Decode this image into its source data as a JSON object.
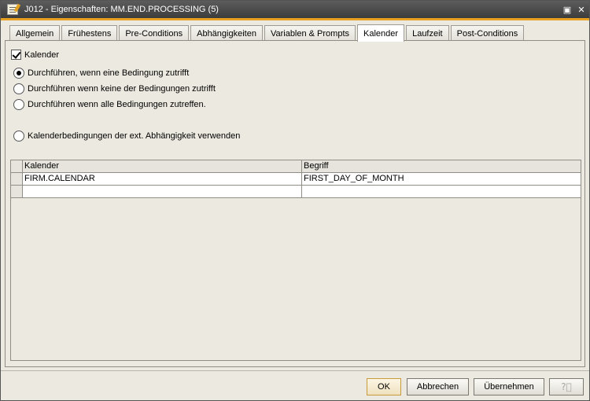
{
  "window": {
    "title": "J012 - Eigenschaften: MM.END.PROCESSING (5)",
    "maximize_glyph": "▣",
    "close_glyph": "✕"
  },
  "tabs": [
    {
      "label": "Allgemein",
      "active": false
    },
    {
      "label": "Frühestens",
      "active": false
    },
    {
      "label": "Pre-Conditions",
      "active": false
    },
    {
      "label": "Abhängigkeiten",
      "active": false
    },
    {
      "label": "Variablen & Prompts",
      "active": false
    },
    {
      "label": "Kalender",
      "active": true
    },
    {
      "label": "Laufzeit",
      "active": false
    },
    {
      "label": "Post-Conditions",
      "active": false
    }
  ],
  "calendar": {
    "checkbox_label": "Kalender",
    "checked": true,
    "options": [
      {
        "label": "Durchführen, wenn eine Bedingung zutrifft",
        "selected": true
      },
      {
        "label": "Durchführen wenn keine der Bedingungen zutrifft",
        "selected": false
      },
      {
        "label": "Durchführen wenn alle Bedingungen zutreffen.",
        "selected": false
      },
      {
        "label": "Kalenderbedingungen der ext. Abhängigkeit verwenden",
        "selected": false
      }
    ],
    "table": {
      "columns": [
        "Kalender",
        "Begriff"
      ],
      "rows": [
        [
          "FIRM.CALENDAR",
          "FIRST_DAY_OF_MONTH"
        ],
        [
          "",
          ""
        ]
      ]
    }
  },
  "buttons": {
    "ok": "OK",
    "cancel": "Abbrechen",
    "apply": "Übernehmen",
    "help_icon": "help-icon"
  },
  "colors": {
    "title_accent": "#e8a020"
  }
}
